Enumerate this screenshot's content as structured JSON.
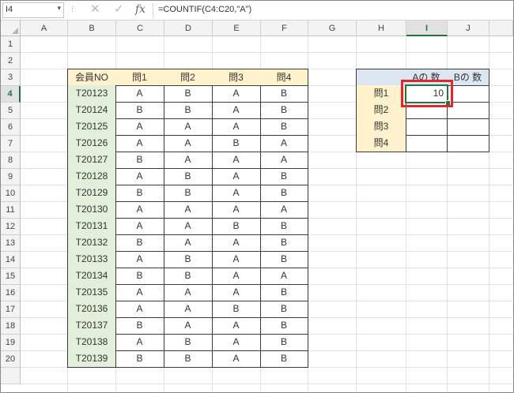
{
  "formula_bar": {
    "name_box": "I4",
    "formula": "=COUNTIF(C4:C20,\"A\")",
    "cancel_icon": "✕",
    "enter_icon": "✓",
    "fx_label": "fx"
  },
  "columns": [
    "A",
    "B",
    "C",
    "D",
    "E",
    "F",
    "G",
    "H",
    "I",
    "J"
  ],
  "rows": [
    "1",
    "2",
    "3",
    "4",
    "5",
    "6",
    "7",
    "8",
    "9",
    "10",
    "11",
    "12",
    "13",
    "14",
    "15",
    "16",
    "17",
    "18",
    "19",
    "20"
  ],
  "selected_cell": {
    "column": "I",
    "row": "4"
  },
  "member_table": {
    "headers": [
      "会員NO",
      "問1",
      "問2",
      "問3",
      "問4"
    ],
    "rows": [
      [
        "T20123",
        "A",
        "B",
        "A",
        "B"
      ],
      [
        "T20124",
        "B",
        "B",
        "A",
        "B"
      ],
      [
        "T20125",
        "A",
        "A",
        "A",
        "B"
      ],
      [
        "T20126",
        "A",
        "A",
        "B",
        "A"
      ],
      [
        "T20127",
        "B",
        "A",
        "A",
        "A"
      ],
      [
        "T20128",
        "A",
        "B",
        "A",
        "B"
      ],
      [
        "T20129",
        "B",
        "B",
        "A",
        "B"
      ],
      [
        "T20130",
        "A",
        "A",
        "A",
        "A"
      ],
      [
        "T20131",
        "A",
        "A",
        "B",
        "B"
      ],
      [
        "T20132",
        "B",
        "A",
        "A",
        "B"
      ],
      [
        "T20133",
        "A",
        "B",
        "A",
        "B"
      ],
      [
        "T20134",
        "B",
        "B",
        "A",
        "A"
      ],
      [
        "T20135",
        "A",
        "A",
        "A",
        "B"
      ],
      [
        "T20136",
        "A",
        "A",
        "B",
        "B"
      ],
      [
        "T20137",
        "B",
        "A",
        "A",
        "B"
      ],
      [
        "T20138",
        "A",
        "B",
        "A",
        "B"
      ],
      [
        "T20139",
        "B",
        "B",
        "A",
        "B"
      ]
    ]
  },
  "summary_table": {
    "headers": [
      "",
      "Aの 数",
      "Bの 数"
    ],
    "rows": [
      [
        "問1",
        "10",
        ""
      ],
      [
        "問2",
        "",
        ""
      ],
      [
        "問3",
        "",
        ""
      ],
      [
        "問4",
        "",
        ""
      ]
    ]
  }
}
